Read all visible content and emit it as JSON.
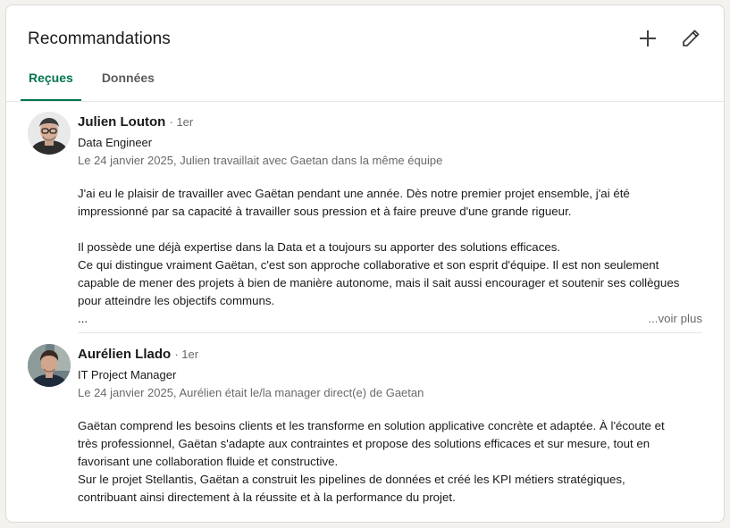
{
  "section": {
    "title": "Recommandations",
    "tabs": [
      {
        "label": "Reçues",
        "active": true
      },
      {
        "label": "Données",
        "active": false
      }
    ],
    "accent_color": "#01754f"
  },
  "actions": {
    "add_icon": "plus-icon",
    "edit_icon": "pencil-icon"
  },
  "recommendations": [
    {
      "name": "Julien Louton",
      "degree": "· 1er",
      "headline": "Data Engineer",
      "meta": "Le 24 janvier 2025, Julien travaillait avec Gaetan dans la même équipe",
      "lines": [
        "J'ai eu le plaisir de travailler avec Gaëtan pendant une année. Dès notre premier projet ensemble, j'ai été",
        "impressionné par sa capacité à travailler sous pression et à faire preuve d'une grande rigueur.",
        "",
        "Il possède une déjà expertise dans la Data et a toujours su apporter des solutions efficaces.",
        "Ce qui distingue vraiment Gaëtan, c'est son approche collaborative et son esprit d'équipe. Il est non seulement",
        "capable de mener des projets à bien de manière autonome, mais il sait aussi encourager et soutenir ses collègues",
        "pour atteindre les objectifs communs."
      ],
      "ellipsis": "...",
      "see_more": "...voir plus"
    },
    {
      "name": "Aurélien Llado",
      "degree": "· 1er",
      "headline": "IT Project Manager",
      "meta": "Le 24 janvier 2025, Aurélien était le/la manager direct(e) de Gaetan",
      "lines": [
        "Gaëtan comprend les besoins clients et les transforme en solution applicative concrète et adaptée. À l'écoute et",
        "très professionnel, Gaëtan s'adapte aux contraintes et propose des solutions efficaces et sur mesure, tout en",
        "favorisant une collaboration fluide et constructive.",
        "Sur le projet Stellantis, Gaëtan a construit les pipelines de données et créé les KPI métiers stratégiques,",
        "contribuant ainsi directement à la réussite et à la performance du projet."
      ]
    }
  ]
}
